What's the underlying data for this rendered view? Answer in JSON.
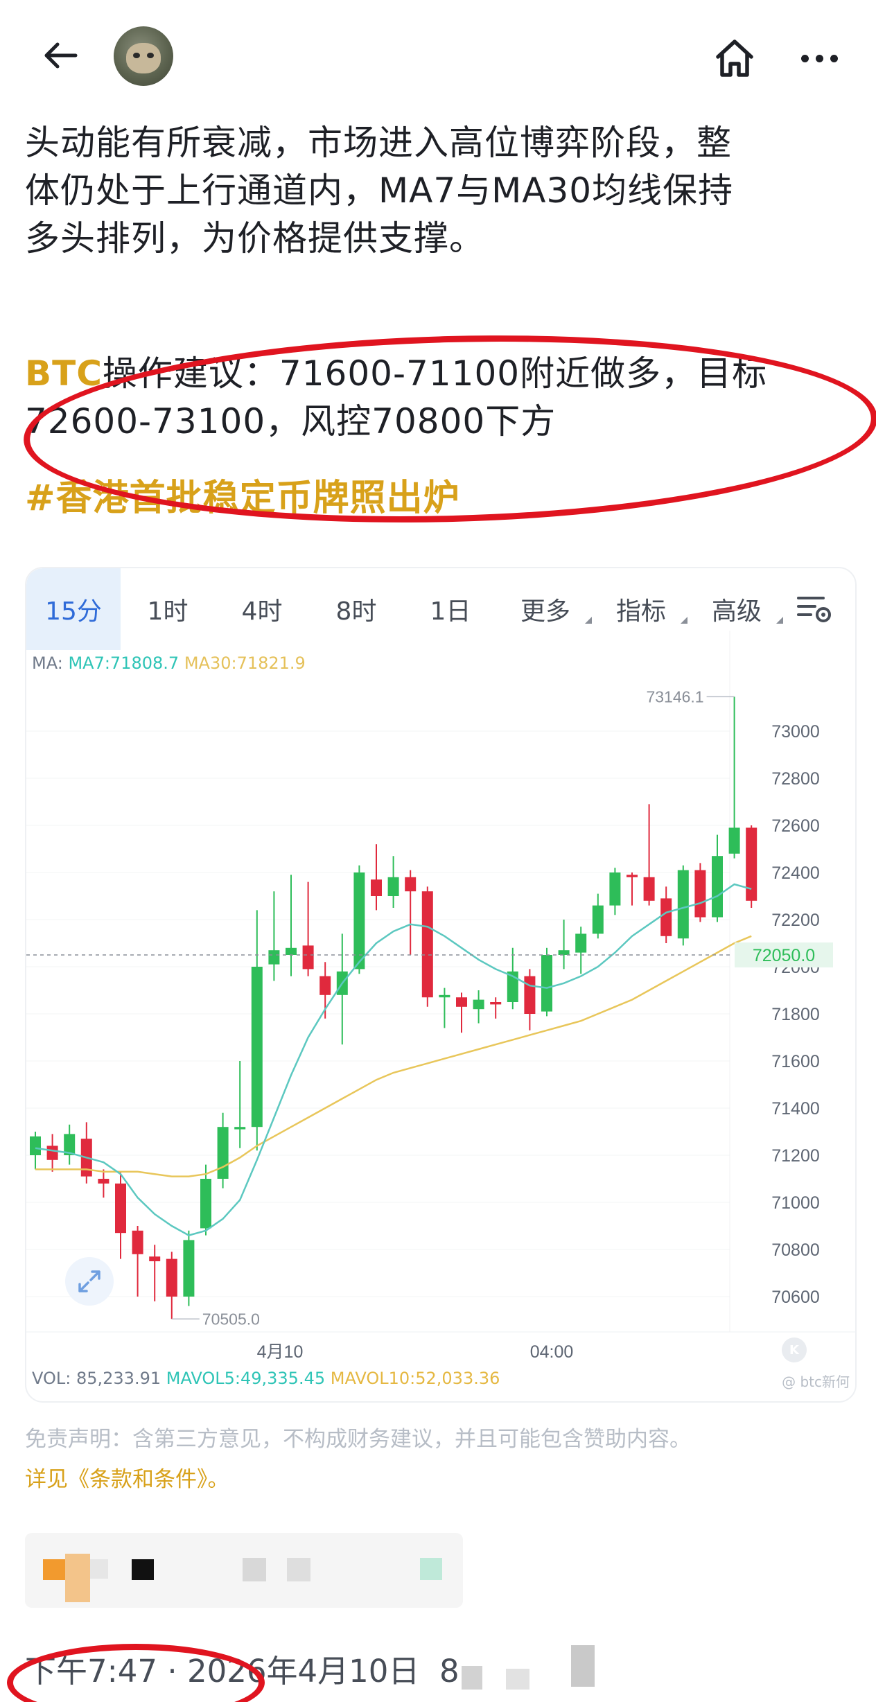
{
  "header": {
    "back_icon": "back-arrow-icon",
    "home_icon": "home-icon",
    "more_icon": "more-dots-icon"
  },
  "post": {
    "paragraph_lines": [
      "头动能有所衰减，市场进入高位博弈阶段，整",
      "体仍处于上行通道内，MA7与MA30均线保持",
      "多头排列，为价格提供支撑。"
    ],
    "advice_symbol": "BTC",
    "advice_line1": "操作建议：71600-71100附近做多，目标",
    "advice_line2": "72600-73100，风控70800下方",
    "hashtag": "#香港首批稳定币牌照出炉"
  },
  "chart": {
    "tabs": [
      {
        "label": "15分",
        "active": true
      },
      {
        "label": "1时",
        "active": false
      },
      {
        "label": "4时",
        "active": false
      },
      {
        "label": "8时",
        "active": false
      },
      {
        "label": "1日",
        "active": false
      },
      {
        "label": "更多",
        "active": false,
        "dropdown": true
      },
      {
        "label": "指标",
        "active": false,
        "dropdown": true
      },
      {
        "label": "高级",
        "active": false,
        "dropdown": true
      }
    ],
    "ma_prefix": "MA:",
    "ma7_label": "MA7:71808.7",
    "ma30_label": "MA30:71821.9",
    "vol_label": "VOL: 85,233.91",
    "mavol5_label": "MAVOL5:49,335.45",
    "mavol10_label": "MAVOL10:52,033.36",
    "watermark": "@ btc新何",
    "current_price_label": "72050.0",
    "high_label": "73146.1",
    "low_label": "70505.0",
    "colors": {
      "up": "#2ebd59",
      "down": "#e0293d",
      "ma7": "#5cc8c0",
      "ma30": "#e8c65a",
      "active_tab": "#2f6bd8"
    }
  },
  "chart_data": {
    "type": "candlestick",
    "ylim": [
      70450,
      73250
    ],
    "yticks": [
      70600,
      70800,
      71000,
      71200,
      71400,
      71600,
      71800,
      72000,
      72200,
      72400,
      72600,
      72800,
      73000
    ],
    "xticks": [
      "4月10",
      "04:00"
    ],
    "candles": [
      {
        "o": 71200,
        "c": 71280,
        "h": 71300,
        "l": 71140
      },
      {
        "o": 71240,
        "c": 71180,
        "h": 71290,
        "l": 71130
      },
      {
        "o": 71200,
        "c": 71290,
        "h": 71330,
        "l": 71160
      },
      {
        "o": 71270,
        "c": 71110,
        "h": 71340,
        "l": 71080
      },
      {
        "o": 71100,
        "c": 71080,
        "h": 71140,
        "l": 71020
      },
      {
        "o": 71080,
        "c": 70870,
        "h": 71130,
        "l": 70760
      },
      {
        "o": 70880,
        "c": 70780,
        "h": 70900,
        "l": 70600
      },
      {
        "o": 70770,
        "c": 70750,
        "h": 70820,
        "l": 70580
      },
      {
        "o": 70760,
        "c": 70600,
        "h": 70790,
        "l": 70505
      },
      {
        "o": 70600,
        "c": 70840,
        "h": 70880,
        "l": 70560
      },
      {
        "o": 70890,
        "c": 71100,
        "h": 71160,
        "l": 70860
      },
      {
        "o": 71100,
        "c": 71320,
        "h": 71380,
        "l": 71060
      },
      {
        "o": 71310,
        "c": 71320,
        "h": 71600,
        "l": 71230
      },
      {
        "o": 71320,
        "c": 72000,
        "h": 72240,
        "l": 71220
      },
      {
        "o": 72010,
        "c": 72070,
        "h": 72320,
        "l": 71940
      },
      {
        "o": 72050,
        "c": 72080,
        "h": 72390,
        "l": 71960
      },
      {
        "o": 72090,
        "c": 71990,
        "h": 72360,
        "l": 71960
      },
      {
        "o": 71960,
        "c": 71880,
        "h": 72020,
        "l": 71780
      },
      {
        "o": 71880,
        "c": 71980,
        "h": 72140,
        "l": 71670
      },
      {
        "o": 71990,
        "c": 72400,
        "h": 72430,
        "l": 71970
      },
      {
        "o": 72370,
        "c": 72300,
        "h": 72520,
        "l": 72240
      },
      {
        "o": 72300,
        "c": 72380,
        "h": 72470,
        "l": 72250
      },
      {
        "o": 72380,
        "c": 72320,
        "h": 72410,
        "l": 72050
      },
      {
        "o": 72320,
        "c": 71870,
        "h": 72340,
        "l": 71830
      },
      {
        "o": 71870,
        "c": 71880,
        "h": 71910,
        "l": 71740
      },
      {
        "o": 71870,
        "c": 71830,
        "h": 71890,
        "l": 71720
      },
      {
        "o": 71820,
        "c": 71860,
        "h": 71900,
        "l": 71760
      },
      {
        "o": 71850,
        "c": 71840,
        "h": 71870,
        "l": 71780
      },
      {
        "o": 71850,
        "c": 71980,
        "h": 72080,
        "l": 71820
      },
      {
        "o": 71960,
        "c": 71800,
        "h": 71990,
        "l": 71730
      },
      {
        "o": 71810,
        "c": 72050,
        "h": 72080,
        "l": 71790
      },
      {
        "o": 72050,
        "c": 72070,
        "h": 72200,
        "l": 71990
      },
      {
        "o": 72060,
        "c": 72140,
        "h": 72170,
        "l": 71970
      },
      {
        "o": 72140,
        "c": 72260,
        "h": 72310,
        "l": 72120
      },
      {
        "o": 72260,
        "c": 72400,
        "h": 72420,
        "l": 72220
      },
      {
        "o": 72390,
        "c": 72380,
        "h": 72400,
        "l": 72260
      },
      {
        "o": 72380,
        "c": 72280,
        "h": 72690,
        "l": 72260
      },
      {
        "o": 72290,
        "c": 72130,
        "h": 72340,
        "l": 72100
      },
      {
        "o": 72120,
        "c": 72410,
        "h": 72430,
        "l": 72090
      },
      {
        "o": 72410,
        "c": 72210,
        "h": 72440,
        "l": 72190
      },
      {
        "o": 72210,
        "c": 72470,
        "h": 72560,
        "l": 72190
      },
      {
        "o": 72480,
        "c": 72590,
        "h": 73146.1,
        "l": 72460
      },
      {
        "o": 72590,
        "c": 72280,
        "h": 72600,
        "l": 72250
      }
    ],
    "ma7": [
      71230,
      71220,
      71210,
      71190,
      71170,
      71120,
      71020,
      70950,
      70900,
      70860,
      70880,
      70930,
      71010,
      71180,
      71360,
      71540,
      71700,
      71820,
      71930,
      72020,
      72100,
      72150,
      72180,
      72170,
      72130,
      72080,
      72030,
      71990,
      71960,
      71920,
      71910,
      71930,
      71960,
      72000,
      72060,
      72130,
      72180,
      72230,
      72250,
      72270,
      72300,
      72350,
      72330
    ],
    "ma30": [
      71140,
      71140,
      71140,
      71140,
      71130,
      71130,
      71130,
      71120,
      71110,
      71110,
      71120,
      71150,
      71190,
      71240,
      71280,
      71320,
      71360,
      71400,
      71440,
      71480,
      71520,
      71550,
      71570,
      71590,
      71610,
      71630,
      71650,
      71670,
      71690,
      71710,
      71730,
      71750,
      71770,
      71800,
      71830,
      71860,
      71900,
      71940,
      71980,
      72020,
      72060,
      72100,
      72130
    ]
  },
  "footer": {
    "disclaimer": "免责声明：含第三方意见，不构成财务建议，并且可能包含赞助内容。",
    "terms_link": "详见《条款和条件》。",
    "timestamp": "下午7:47 · 2026年4月10日",
    "views_prefix": "8"
  }
}
